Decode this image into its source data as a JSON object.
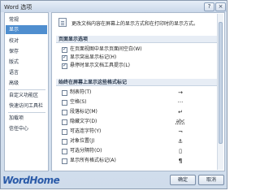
{
  "window": {
    "title": "Word 选项",
    "help": "?",
    "close": "×"
  },
  "sidebar": {
    "items": [
      {
        "label": "常规",
        "selected": false
      },
      {
        "label": "显示",
        "selected": true
      },
      {
        "label": "校对",
        "selected": false
      },
      {
        "label": "保存",
        "selected": false
      },
      {
        "label": "版式",
        "selected": false
      },
      {
        "label": "语言",
        "selected": false
      },
      {
        "label": "高级",
        "selected": false
      },
      {
        "label": "自定义功能区",
        "selected": false
      },
      {
        "label": "快速访问工具栏",
        "selected": false
      },
      {
        "label": "加载项",
        "selected": false
      },
      {
        "label": "信任中心",
        "selected": false
      }
    ]
  },
  "main": {
    "intro": "更改文档内容在屏幕上的显示方式和在打印时的显示方式。",
    "page_section": {
      "title": "页面显示选项",
      "options": [
        {
          "label": "在页面视图中显示页面间空白(W)",
          "checked": true
        },
        {
          "label": "显示突出显示标记(H)",
          "checked": true
        },
        {
          "label": "悬停时显示文档工具提示(L)",
          "checked": true
        }
      ]
    },
    "format_section": {
      "title": "始终在屏幕上显示这些格式标记",
      "options": [
        {
          "label": "制表符(T)",
          "mark": "→",
          "checked": false
        },
        {
          "label": "空格(S)",
          "mark": "···",
          "checked": false
        },
        {
          "label": "段落标记(M)",
          "mark": "↵",
          "checked": false
        },
        {
          "label": "隐藏文字(D)",
          "mark": "abc",
          "checked": false
        },
        {
          "label": "可选连字符(Y)",
          "mark": "¬",
          "checked": false
        },
        {
          "label": "对象位置(J)",
          "mark": "⚓",
          "checked": false
        },
        {
          "label": "可选分隔符(O)",
          "mark": "▯",
          "checked": false
        },
        {
          "label": "显示所有格式标记(A)",
          "mark": "",
          "checked": false
        }
      ]
    }
  },
  "footer": {
    "ok": "确定",
    "cancel": "取消"
  },
  "watermark": "WordHome"
}
